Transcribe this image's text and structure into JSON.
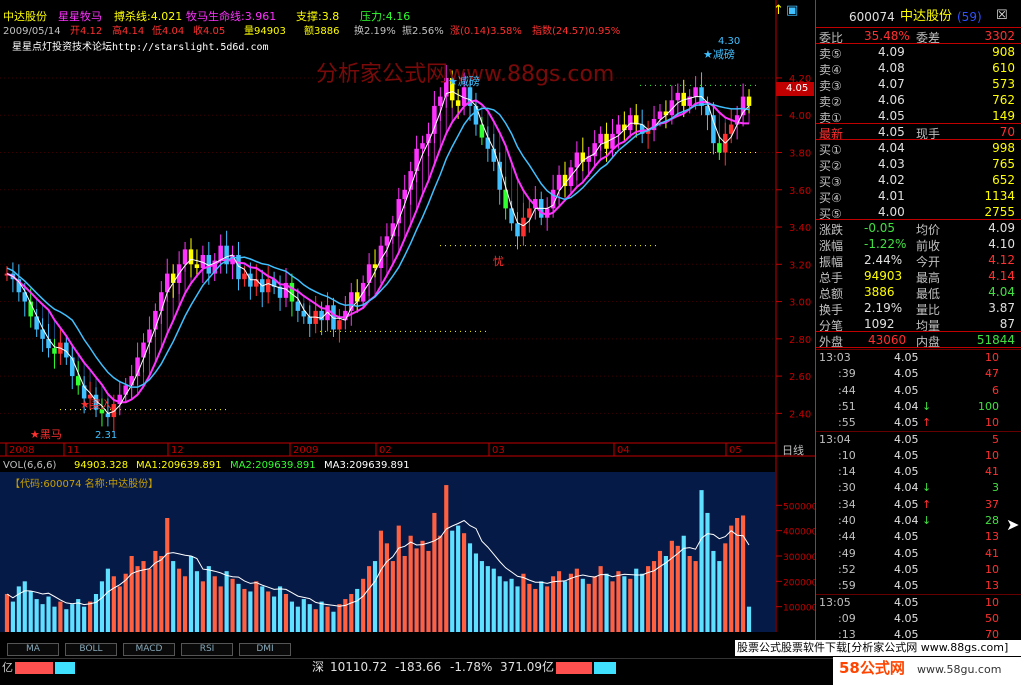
{
  "header": {
    "stock_name": "中达股份",
    "indicator": "星星牧马",
    "kill_label": "搏杀线:4.021",
    "life_label": "牧马生命线:3.961",
    "support_label": "支撑:3.8",
    "pressure_label": "压力:4.16",
    "date": "2009/05/14",
    "open": "开4.12",
    "high": "高4.14",
    "low": "低4.04",
    "close": "收4.05",
    "vol": "量94903",
    "amount": "额3886",
    "turnover": "换2.19%",
    "amplitude": "振2.56%",
    "change": "涨(0.14)3.58%",
    "index": "指数(24.57)0.95%",
    "forum": "星星点灯投资技术论坛http://starslight.5d6d.com",
    "watermark": "分析家公式网www.88gs.com"
  },
  "colors": {
    "up": "#ff3030",
    "down": "#40c0ff",
    "ma_purple": "#ff33ff",
    "accent_yellow": "#ffff00",
    "green": "#30ff30",
    "axis": "#c00000"
  },
  "chart_data": {
    "type": "candlestick",
    "ylim": [
      2.3,
      4.35
    ],
    "y_ticks": [
      "4.20",
      "4.00",
      "3.80",
      "3.60",
      "3.40",
      "3.20",
      "3.00",
      "2.80",
      "2.60",
      "2.40"
    ],
    "x_ticks": [
      "2008",
      "11",
      "12",
      "2009",
      "02",
      "03",
      "04",
      "05"
    ],
    "x_end_label": "日线",
    "current_price": "4.05",
    "annotations": [
      {
        "text": "★黑马",
        "price": 2.31,
        "color": "#ff3030"
      },
      {
        "text": "2.31",
        "price": 2.31,
        "color": "#40c0ff"
      },
      {
        "text": "★买入",
        "price": 2.4,
        "color": "#ff3030"
      },
      {
        "text": "★减磅",
        "price": 4.05,
        "color": "#40c0ff"
      },
      {
        "text": "4.30",
        "price": 4.3,
        "color": "#40c0ff"
      },
      {
        "text": "★减磅",
        "price": 4.2,
        "color": "#40c0ff"
      },
      {
        "text": "忧",
        "price": 3.2,
        "color": "#ff3030"
      }
    ],
    "close": [
      3.15,
      3.12,
      3.05,
      3.0,
      2.92,
      2.85,
      2.8,
      2.75,
      2.72,
      2.78,
      2.7,
      2.6,
      2.55,
      2.48,
      2.5,
      2.42,
      2.4,
      2.38,
      2.45,
      2.5,
      2.55,
      2.6,
      2.7,
      2.78,
      2.85,
      2.95,
      3.05,
      3.15,
      3.1,
      3.2,
      3.28,
      3.2,
      3.18,
      3.25,
      3.15,
      3.22,
      3.3,
      3.2,
      3.25,
      3.12,
      3.15,
      3.08,
      3.12,
      3.05,
      3.12,
      3.08,
      3.02,
      3.1,
      3.0,
      2.95,
      2.92,
      2.88,
      2.95,
      2.9,
      2.98,
      2.85,
      2.9,
      2.95,
      3.05,
      3.0,
      3.1,
      3.2,
      3.18,
      3.3,
      3.35,
      3.42,
      3.55,
      3.6,
      3.7,
      3.82,
      3.85,
      3.9,
      4.05,
      4.1,
      4.2,
      4.08,
      4.05,
      4.15,
      4.05,
      3.95,
      3.88,
      3.82,
      3.75,
      3.6,
      3.5,
      3.42,
      3.35,
      3.45,
      3.5,
      3.55,
      3.45,
      3.5,
      3.6,
      3.68,
      3.62,
      3.72,
      3.8,
      3.75,
      3.78,
      3.85,
      3.9,
      3.82,
      3.9,
      3.95,
      3.92,
      4.0,
      3.95,
      3.9,
      3.92,
      3.98,
      4.02,
      4.0,
      4.08,
      4.12,
      4.05,
      4.1,
      4.15,
      4.05,
      4.0,
      3.85,
      3.8,
      3.9,
      3.95,
      4.0,
      4.1,
      4.05
    ],
    "volume": [
      150000,
      120000,
      180000,
      200000,
      160000,
      130000,
      110000,
      140000,
      100000,
      120000,
      90000,
      110000,
      130000,
      100000,
      120000,
      150000,
      200000,
      250000,
      220000,
      180000,
      230000,
      300000,
      260000,
      280000,
      250000,
      320000,
      300000,
      450000,
      280000,
      250000,
      220000,
      300000,
      240000,
      200000,
      260000,
      220000,
      180000,
      240000,
      210000,
      190000,
      170000,
      160000,
      200000,
      180000,
      160000,
      140000,
      180000,
      150000,
      120000,
      100000,
      130000,
      110000,
      90000,
      120000,
      100000,
      80000,
      110000,
      130000,
      150000,
      170000,
      210000,
      260000,
      280000,
      400000,
      350000,
      280000,
      420000,
      300000,
      380000,
      330000,
      360000,
      320000,
      470000,
      380000,
      580000,
      400000,
      420000,
      390000,
      350000,
      310000,
      280000,
      260000,
      250000,
      220000,
      200000,
      210000,
      180000,
      230000,
      190000,
      170000,
      200000,
      180000,
      220000,
      240000,
      200000,
      230000,
      250000,
      210000,
      190000,
      220000,
      260000,
      230000,
      200000,
      240000,
      220000,
      210000,
      250000,
      230000,
      260000,
      280000,
      320000,
      300000,
      360000,
      340000,
      380000,
      300000,
      280000,
      560000,
      470000,
      320000,
      280000,
      350000,
      420000,
      450000,
      460000,
      100000
    ],
    "vol_ticks": [
      "500000",
      "400000",
      "300000",
      "200000",
      "100000"
    ],
    "vol_ylim": [
      0,
      600000
    ]
  },
  "vol_header": {
    "label": "VOL(6,6,6)",
    "v": "94903.328",
    "ma1": "MA1:209639.891",
    "ma2": "MA2:209639.891",
    "ma3": "MA3:209639.891",
    "code_label": "【代码:600074 名称:中达股份】"
  },
  "tabs": [
    "MA",
    "BOLL",
    "MACD",
    "RSI",
    "DMI"
  ],
  "status": {
    "market_label": "深",
    "index": "10110.72",
    "change": "-183.66",
    "pct": "-1.78%",
    "turnover": "371.09亿",
    "ad_text": "股票公式股票软件下载[分析家公式网 www.88gs.com]",
    "logo": "58公式网",
    "logo_url": "www.58gu.com",
    "left_cut": "亿"
  },
  "quote": {
    "code": "600074",
    "name": "中达股份",
    "num": "(59)",
    "wei_bi_label": "委比",
    "wei_bi": "35.48%",
    "wei_cha_label": "委差",
    "wei_cha": "3302",
    "sells": [
      {
        "label": "卖⑤",
        "price": "4.09",
        "vol": "908"
      },
      {
        "label": "卖④",
        "price": "4.08",
        "vol": "610"
      },
      {
        "label": "卖③",
        "price": "4.07",
        "vol": "573"
      },
      {
        "label": "卖②",
        "price": "4.06",
        "vol": "762"
      },
      {
        "label": "卖①",
        "price": "4.05",
        "vol": "149"
      }
    ],
    "last": {
      "label": "最新",
      "price": "4.05",
      "label2": "现手",
      "val": "70"
    },
    "buys": [
      {
        "label": "买①",
        "price": "4.04",
        "vol": "998"
      },
      {
        "label": "买②",
        "price": "4.03",
        "vol": "765"
      },
      {
        "label": "买③",
        "price": "4.02",
        "vol": "652"
      },
      {
        "label": "买④",
        "price": "4.01",
        "vol": "1134"
      },
      {
        "label": "买⑤",
        "price": "4.00",
        "vol": "2755"
      }
    ],
    "stats": [
      {
        "l1": "涨跌",
        "v1": "-0.05",
        "l2": "均价",
        "v2": "4.09"
      },
      {
        "l1": "涨幅",
        "v1": "-1.22%",
        "l2": "前收",
        "v2": "4.10"
      },
      {
        "l1": "振幅",
        "v1": "2.44%",
        "l2": "今开",
        "v2": "4.12"
      },
      {
        "l1": "总手",
        "v1": "94903",
        "l2": "最高",
        "v2": "4.14"
      },
      {
        "l1": "总额",
        "v1": "3886",
        "l2": "最低",
        "v2": "4.04"
      },
      {
        "l1": "换手",
        "v1": "2.19%",
        "l2": "量比",
        "v2": "3.87"
      },
      {
        "l1": "分笔",
        "v1": "1092",
        "l2": "均量",
        "v2": "87"
      }
    ],
    "outer_label": "外盘",
    "outer": "43060",
    "inner_label": "内盘",
    "inner": "51844",
    "ticks": [
      {
        "time": "13:03",
        "price": "4.05",
        "arrow": "",
        "vol": "10"
      },
      {
        "time": ":39",
        "price": "4.05",
        "arrow": "",
        "vol": "47"
      },
      {
        "time": ":44",
        "price": "4.05",
        "arrow": "",
        "vol": "6"
      },
      {
        "time": ":51",
        "price": "4.04",
        "arrow": "↓",
        "vol": "100"
      },
      {
        "time": ":55",
        "price": "4.05",
        "arrow": "↑",
        "vol": "10"
      },
      {
        "time": "13:04",
        "price": "4.05",
        "arrow": "",
        "vol": "5"
      },
      {
        "time": ":10",
        "price": "4.05",
        "arrow": "",
        "vol": "10"
      },
      {
        "time": ":14",
        "price": "4.05",
        "arrow": "",
        "vol": "41"
      },
      {
        "time": ":30",
        "price": "4.04",
        "arrow": "↓",
        "vol": "3"
      },
      {
        "time": ":34",
        "price": "4.05",
        "arrow": "↑",
        "vol": "37"
      },
      {
        "time": ":40",
        "price": "4.04",
        "arrow": "↓",
        "vol": "28"
      },
      {
        "time": ":44",
        "price": "4.05",
        "arrow": "",
        "vol": "13"
      },
      {
        "time": ":49",
        "price": "4.05",
        "arrow": "",
        "vol": "41"
      },
      {
        "time": ":52",
        "price": "4.05",
        "arrow": "",
        "vol": "10"
      },
      {
        "time": ":59",
        "price": "4.05",
        "arrow": "",
        "vol": "13"
      },
      {
        "time": "13:05",
        "price": "4.05",
        "arrow": "",
        "vol": "10"
      },
      {
        "time": ":09",
        "price": "4.05",
        "arrow": "",
        "vol": "50"
      },
      {
        "time": ":13",
        "price": "4.05",
        "arrow": "",
        "vol": "70"
      }
    ]
  }
}
